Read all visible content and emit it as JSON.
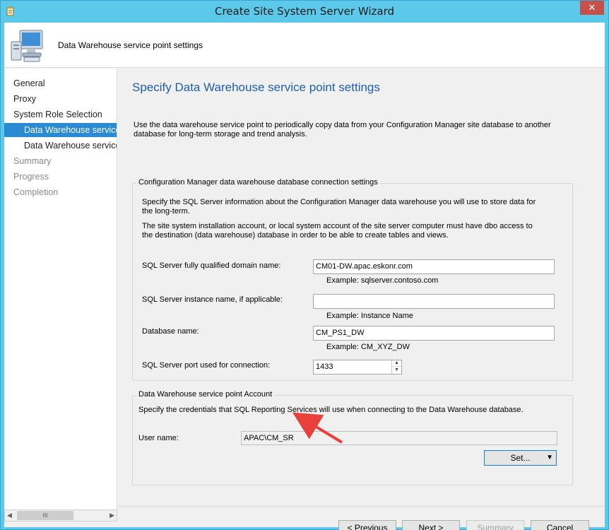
{
  "window": {
    "title": "Create Site System Server Wizard",
    "close_glyph": "✕"
  },
  "header": {
    "subtitle": "Data Warehouse service point settings"
  },
  "nav": {
    "items": [
      {
        "label": "General",
        "state": "normal",
        "indent": false
      },
      {
        "label": "Proxy",
        "state": "normal",
        "indent": false
      },
      {
        "label": "System Role Selection",
        "state": "normal",
        "indent": false
      },
      {
        "label": "Data Warehouse service p",
        "state": "selected",
        "indent": true
      },
      {
        "label": "Data Warehouse service p",
        "state": "normal",
        "indent": true
      },
      {
        "label": "Summary",
        "state": "disabled",
        "indent": false
      },
      {
        "label": "Progress",
        "state": "disabled",
        "indent": false
      },
      {
        "label": "Completion",
        "state": "disabled",
        "indent": false
      }
    ],
    "scroll_left": "◀",
    "scroll_right": "▶",
    "scroll_thumb": "III"
  },
  "main": {
    "title": "Specify Data Warehouse service point settings",
    "intro": "Use the data warehouse service point to periodically copy data from your Configuration Manager site database to another database for long-term storage and trend analysis.",
    "connection_group": {
      "title": "Configuration Manager data warehouse database connection settings",
      "desc1": "Specify the SQL Server information about the Configuration Manager data warehouse you will use to store data for the long-term.",
      "desc2": "The site system installation account, or local system account of the site server computer must have dbo access to the destination (data warehouse) database in order to be able to create tables and views.",
      "fqdn_label": "SQL Server fully qualified domain name:",
      "fqdn_value": "CM01-DW.apac.eskonr.com",
      "fqdn_example": "Example: sqlserver.contoso.com",
      "instance_label": "SQL Server instance name, if applicable:",
      "instance_value": "",
      "instance_example": "Example: Instance Name",
      "db_label": "Database name:",
      "db_value": "CM_PS1_DW",
      "db_example": "Example: CM_XYZ_DW",
      "port_label": "SQL Server port used for connection:",
      "port_value": "1433"
    },
    "account_group": {
      "title": "Data Warehouse service point Account",
      "desc": "Specify the credentials that SQL Reporting Services will use when connecting to the Data Warehouse database.",
      "user_label": "User name:",
      "user_value": "APAC\\CM_SR",
      "set_button": "Set...",
      "set_dropdown_glyph": "▼"
    }
  },
  "footer": {
    "previous": "< Previous",
    "next": "Next >",
    "summary": "Summary",
    "cancel": "Cancel"
  },
  "colors": {
    "accent": "#2a8ad4",
    "title_blue": "#1f5fa8",
    "annotation_arrow": "#e8413b",
    "chrome": "#5cc8ea"
  }
}
